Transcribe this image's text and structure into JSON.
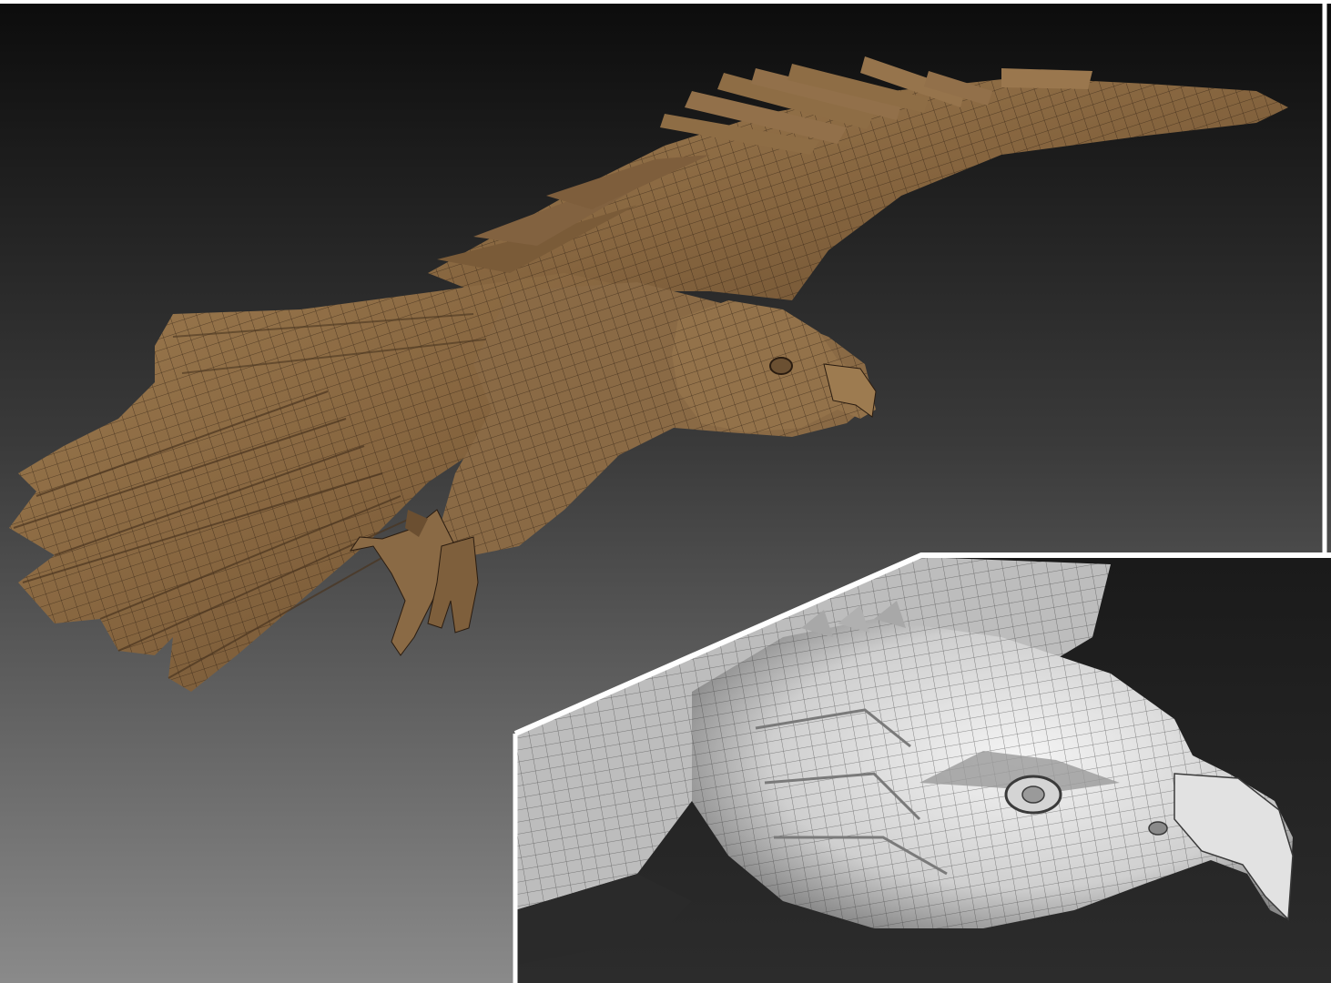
{
  "render": {
    "main_view": {
      "subject": "eagle-in-flight-wireframe-model",
      "material_color": "#8a6a45",
      "material_highlight": "#a88558",
      "material_shadow": "#5a4128",
      "wire_color": "#2a1c10",
      "background_top": "#0c0c0c",
      "background_bottom": "#858585"
    },
    "inset_view": {
      "subject": "eagle-head-closeup-wireframe",
      "material_color": "#d8d8d8",
      "material_highlight": "#f4f4f4",
      "material_shadow": "#8a8a8a",
      "wire_color": "#3a3a3a",
      "background_color": "#1a1a1a"
    },
    "frame_color": "#ffffff"
  }
}
